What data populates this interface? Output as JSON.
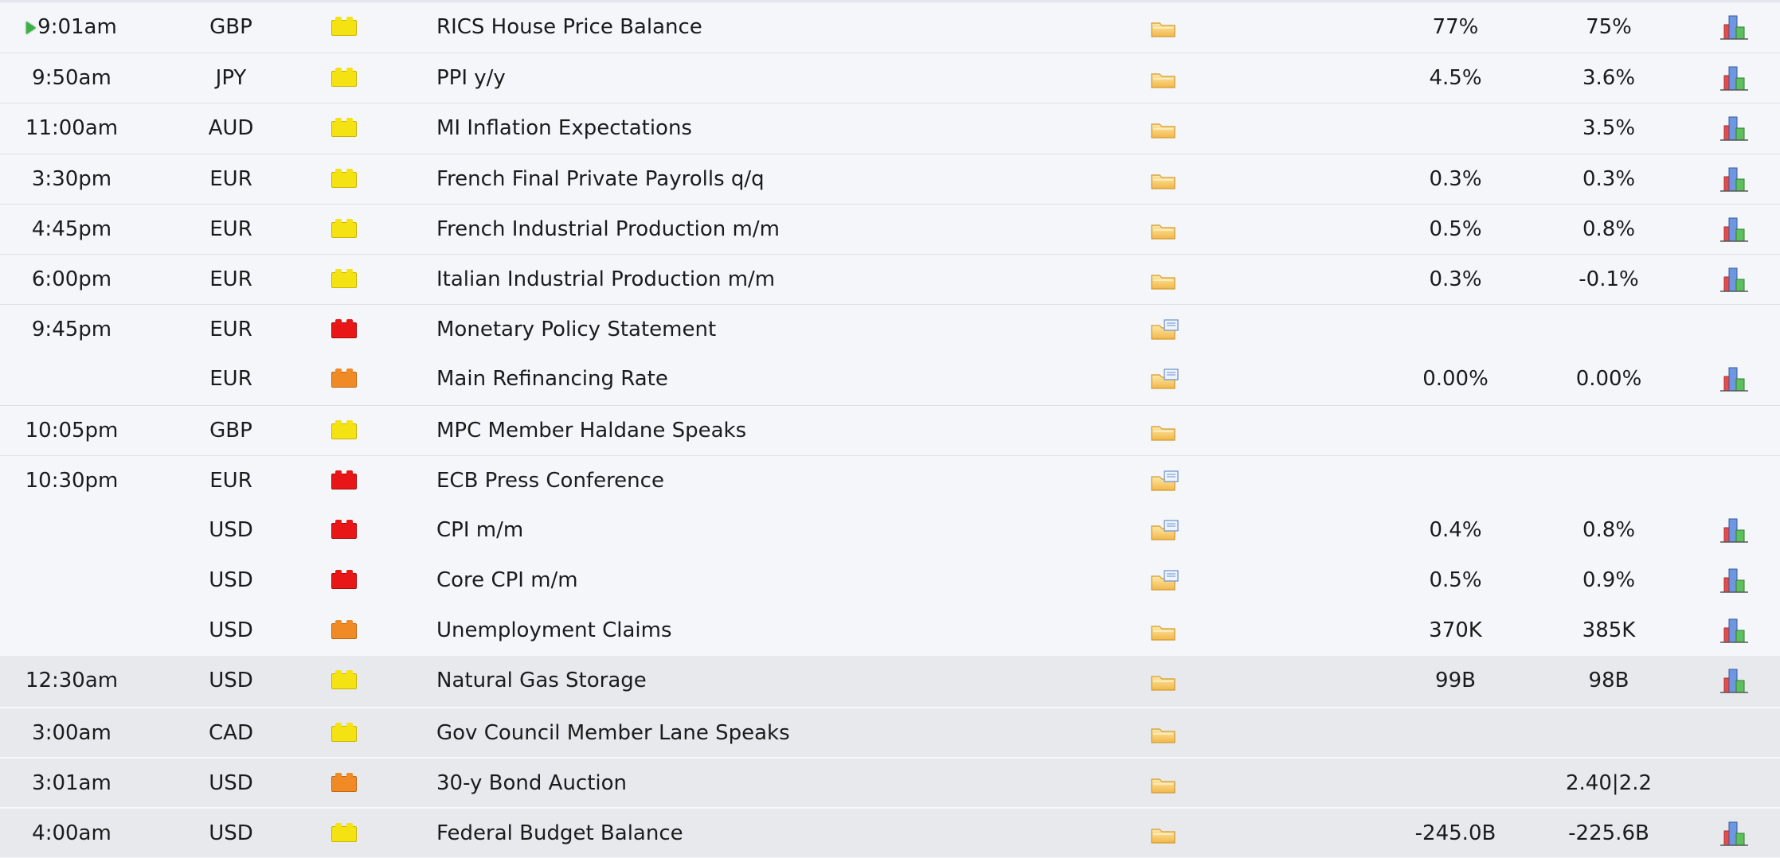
{
  "colors": {
    "impact_high": "#e81616",
    "impact_medium": "#f08a24",
    "impact_low": "#f4e213",
    "row_bg": "#f4f6fa",
    "row_bg_next_day": "#e8e9ed"
  },
  "rows": [
    {
      "time": "9:01am",
      "current": true,
      "currency": "GBP",
      "impact": "yellow",
      "event": "RICS House Price Balance",
      "detail_icon": "folder-icon",
      "actual": "77%",
      "forecast": "75%",
      "graph": true,
      "sep": false,
      "dim": false
    },
    {
      "time": "9:50am",
      "currency": "JPY",
      "impact": "yellow",
      "event": "PPI y/y",
      "detail_icon": "folder-icon",
      "actual": "4.5%",
      "forecast": "3.6%",
      "graph": true,
      "sep": true,
      "dim": false
    },
    {
      "time": "11:00am",
      "currency": "AUD",
      "impact": "yellow",
      "event": "MI Inflation Expectations",
      "detail_icon": "folder-icon",
      "actual": "",
      "forecast": "3.5%",
      "graph": true,
      "sep": true,
      "dim": false
    },
    {
      "time": "3:30pm",
      "currency": "EUR",
      "impact": "yellow",
      "event": "French Final Private Payrolls q/q",
      "detail_icon": "folder-icon",
      "actual": "0.3%",
      "forecast": "0.3%",
      "graph": true,
      "sep": true,
      "dim": false
    },
    {
      "time": "4:45pm",
      "currency": "EUR",
      "impact": "yellow",
      "event": "French Industrial Production m/m",
      "detail_icon": "folder-icon",
      "actual": "0.5%",
      "forecast": "0.8%",
      "graph": true,
      "sep": true,
      "dim": false
    },
    {
      "time": "6:00pm",
      "currency": "EUR",
      "impact": "yellow",
      "event": "Italian Industrial Production m/m",
      "detail_icon": "folder-icon",
      "actual": "0.3%",
      "forecast": "-0.1%",
      "graph": true,
      "sep": true,
      "dim": false
    },
    {
      "time": "9:45pm",
      "currency": "EUR",
      "impact": "red",
      "event": "Monetary Policy Statement",
      "detail_icon": "folder-doc-icon",
      "actual": "",
      "forecast": "",
      "graph": false,
      "sep": true,
      "dim": false
    },
    {
      "time": "",
      "currency": "EUR",
      "impact": "orange",
      "event": "Main Refinancing Rate",
      "detail_icon": "folder-doc-icon",
      "actual": "0.00%",
      "forecast": "0.00%",
      "graph": true,
      "sep": false,
      "dim": false
    },
    {
      "time": "10:05pm",
      "currency": "GBP",
      "impact": "yellow",
      "event": "MPC Member Haldane Speaks",
      "detail_icon": "folder-icon",
      "actual": "",
      "forecast": "",
      "graph": false,
      "sep": true,
      "dim": false
    },
    {
      "time": "10:30pm",
      "currency": "EUR",
      "impact": "red",
      "event": "ECB Press Conference",
      "detail_icon": "folder-doc-icon",
      "actual": "",
      "forecast": "",
      "graph": false,
      "sep": true,
      "dim": false
    },
    {
      "time": "",
      "currency": "USD",
      "impact": "red",
      "event": "CPI m/m",
      "detail_icon": "folder-doc-icon",
      "actual": "0.4%",
      "forecast": "0.8%",
      "graph": true,
      "sep": false,
      "dim": false
    },
    {
      "time": "",
      "currency": "USD",
      "impact": "red",
      "event": "Core CPI m/m",
      "detail_icon": "folder-doc-icon",
      "actual": "0.5%",
      "forecast": "0.9%",
      "graph": true,
      "sep": false,
      "dim": false
    },
    {
      "time": "",
      "currency": "USD",
      "impact": "orange",
      "event": "Unemployment Claims",
      "detail_icon": "folder-icon",
      "actual": "370K",
      "forecast": "385K",
      "graph": true,
      "sep": false,
      "dim": false
    },
    {
      "time": "12:30am",
      "currency": "USD",
      "impact": "yellow",
      "event": "Natural Gas Storage",
      "detail_icon": "folder-icon",
      "actual": "99B",
      "forecast": "98B",
      "graph": true,
      "sep": false,
      "dim": true
    },
    {
      "time": "3:00am",
      "currency": "CAD",
      "impact": "yellow",
      "event": "Gov Council Member Lane Speaks",
      "detail_icon": "folder-icon",
      "actual": "",
      "forecast": "",
      "graph": false,
      "sep": true,
      "dim": true
    },
    {
      "time": "3:01am",
      "currency": "USD",
      "impact": "orange",
      "event": "30-y Bond Auction",
      "detail_icon": "folder-icon",
      "actual": "",
      "forecast": "2.40|2.2",
      "graph": false,
      "sep": true,
      "dim": true
    },
    {
      "time": "4:00am",
      "currency": "USD",
      "impact": "yellow",
      "event": "Federal Budget Balance",
      "detail_icon": "folder-icon",
      "actual": "-245.0B",
      "forecast": "-225.6B",
      "graph": true,
      "sep": true,
      "dim": true
    }
  ]
}
